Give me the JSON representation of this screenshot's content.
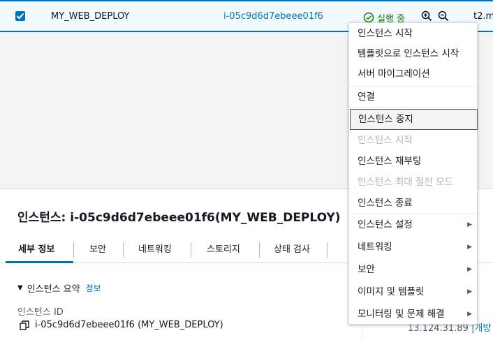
{
  "instance_row": {
    "name": "MY_WEB_DEPLOY",
    "instance_id": "i-05c9d6d7ebeee01f6",
    "state": "실행 중",
    "instance_type": "t2.m",
    "state_color": "#1d8102"
  },
  "context_menu": {
    "groups": [
      [
        "인스턴스 시작",
        "템플릿으로 인스턴스 시작",
        "서버 마이그레이션"
      ],
      [
        "연결"
      ],
      [
        "인스턴스 중지",
        "인스턴스 시작",
        "인스턴스 재부팅",
        "인스턴스 최대 절전 모드",
        "인스턴스 종료"
      ],
      [
        "인스턴스 설정",
        "네트워킹",
        "보안",
        "이미지 및 템플릿",
        "모니터링 및 문제 해결"
      ]
    ],
    "labels": {
      "launch": "인스턴스 시작",
      "launch_template": "템플릿으로 인스턴스 시작",
      "migrate": "서버 마이그레이션",
      "connect": "연결",
      "stop": "인스턴스 중지",
      "start": "인스턴스 시작",
      "reboot": "인스턴스 재부팅",
      "hibernate": "인스턴스 최대 절전 모드",
      "terminate": "인스턴스 종료",
      "settings": "인스턴스 설정",
      "networking": "네트워킹",
      "security": "보안",
      "image_templates": "이미지 및 템플릿",
      "monitoring": "모니터링 및 문제 해결"
    },
    "hovered_item": "인스턴스 중지",
    "disabled_items": [
      "인스턴스 시작",
      "인스턴스 최대 절전 모드"
    ]
  },
  "detail": {
    "title": "인스턴스: i-05c9d6d7ebeee01f6(MY_WEB_DEPLOY)",
    "tabs": [
      "세부 정보",
      "보안",
      "네트워킹",
      "스토리지",
      "상태 검사"
    ],
    "active_tab": "세부 정보",
    "section_title": "인스턴스 요약",
    "section_info": "정보",
    "field_label": "인스턴스 ID",
    "field_value": "i-05c9d6d7ebeee01f6 (MY_WEB_DEPLOY)",
    "ip_partial": "13.124.31.89",
    "open_partial": "개방"
  },
  "icons": {
    "checkbox": "checkbox-checked-icon",
    "state": "check-circle-icon",
    "zoom_in": "zoom-in-icon",
    "zoom_out": "zoom-out-icon",
    "copy": "copy-icon",
    "caret": "caret-down-icon",
    "submenu": "triangle-right-icon"
  },
  "colors": {
    "accent": "#0073bb",
    "running": "#1d8102",
    "disabled_text": "#aab7b8"
  }
}
